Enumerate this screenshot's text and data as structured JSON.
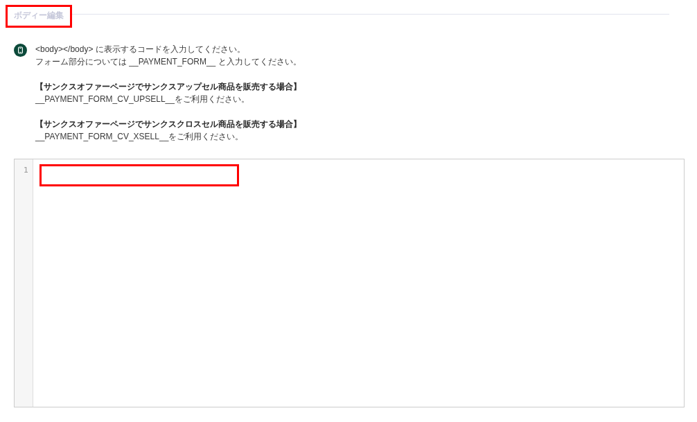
{
  "section": {
    "title": "ボディー編集",
    "highlighted": true
  },
  "notice": {
    "paragraphs": [
      {
        "lines": [
          {
            "kind": "text",
            "text": "<body></body> に表示するコードを入力してください。"
          },
          {
            "kind": "text",
            "text": "フォーム部分については __PAYMENT_FORM__ と入力してください。"
          }
        ]
      },
      {
        "lines": [
          {
            "kind": "heading",
            "text": "【サンクスオファーページでサンクスアップセル商品を販売する場合】"
          },
          {
            "kind": "text",
            "text": "__PAYMENT_FORM_CV_UPSELL__をご利用ください。"
          }
        ]
      },
      {
        "lines": [
          {
            "kind": "heading",
            "text": "【サンクスオファーページでサンクスクロスセル商品を販売する場合】"
          },
          {
            "kind": "text",
            "text": "__PAYMENT_FORM_CV_XSELL__をご利用ください。"
          }
        ]
      }
    ]
  },
  "editor": {
    "lines": [
      {
        "number": "1",
        "highlighted": true
      }
    ]
  }
}
